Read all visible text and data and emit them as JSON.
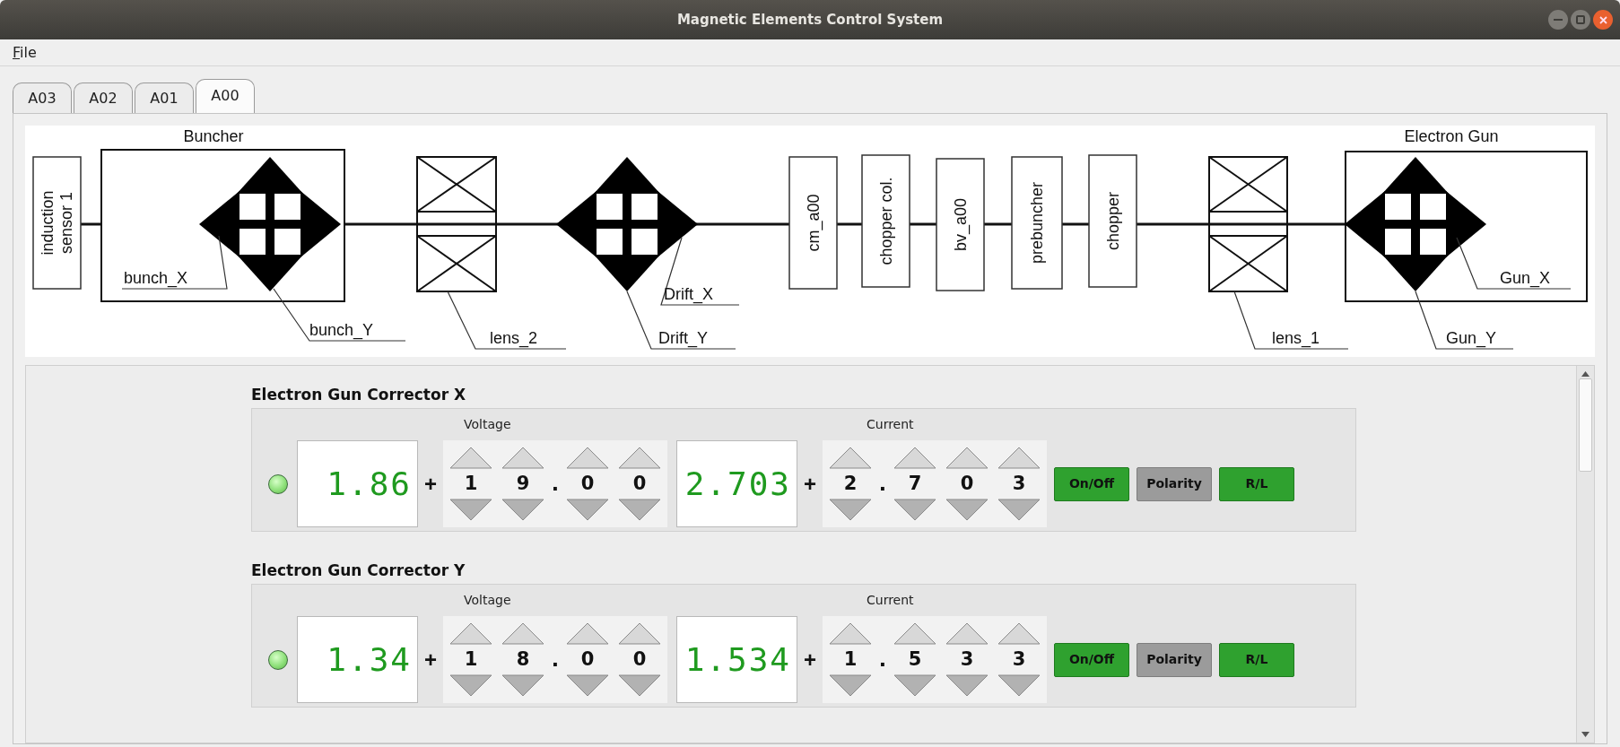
{
  "window": {
    "title": "Magnetic Elements Control System"
  },
  "menu": [
    {
      "label": "File"
    }
  ],
  "tabs": [
    {
      "label": "A03",
      "selected": false
    },
    {
      "label": "A02",
      "selected": false
    },
    {
      "label": "A01",
      "selected": false
    },
    {
      "label": "A00",
      "selected": true
    }
  ],
  "diagram": {
    "frames": [
      {
        "title": "Buncher"
      },
      {
        "title": "Electron Gun"
      }
    ],
    "boxes": [
      {
        "lines": [
          "induction",
          "sensor 1"
        ]
      },
      {
        "lines": [
          "cm_a00"
        ]
      },
      {
        "lines": [
          "chopper col."
        ]
      },
      {
        "lines": [
          "bv_a00"
        ]
      },
      {
        "lines": [
          "prebuncher"
        ]
      },
      {
        "lines": [
          "chopper"
        ]
      }
    ],
    "labels": [
      "bunch_X",
      "bunch_Y",
      "lens_2",
      "Drift_X",
      "Drift_Y",
      "lens_1",
      "Gun_X",
      "Gun_Y"
    ]
  },
  "correctors": [
    {
      "title": "Electron Gun Corrector X",
      "indicator_on": true,
      "voltage": {
        "label": "Voltage",
        "display": "1.86",
        "sign": "+",
        "digits": [
          {
            "kind": "digit",
            "text": "1"
          },
          {
            "kind": "digit",
            "text": "9"
          },
          {
            "kind": "point",
            "text": "."
          },
          {
            "kind": "digit",
            "text": "0"
          },
          {
            "kind": "digit",
            "text": "0"
          }
        ]
      },
      "current": {
        "label": "Current",
        "display": "2.703",
        "sign": "+",
        "digits": [
          {
            "kind": "digit",
            "text": "2"
          },
          {
            "kind": "point",
            "text": "."
          },
          {
            "kind": "digit",
            "text": "7"
          },
          {
            "kind": "digit",
            "text": "0"
          },
          {
            "kind": "digit",
            "text": "3"
          }
        ]
      },
      "buttons": [
        {
          "label": "On/Off",
          "active": true
        },
        {
          "label": "Polarity",
          "active": false
        },
        {
          "label": "R/L",
          "active": true
        }
      ]
    },
    {
      "title": "Electron Gun Corrector Y",
      "indicator_on": true,
      "voltage": {
        "label": "Voltage",
        "display": "1.34",
        "sign": "+",
        "digits": [
          {
            "kind": "digit",
            "text": "1"
          },
          {
            "kind": "digit",
            "text": "8"
          },
          {
            "kind": "point",
            "text": "."
          },
          {
            "kind": "digit",
            "text": "0"
          },
          {
            "kind": "digit",
            "text": "0"
          }
        ]
      },
      "current": {
        "label": "Current",
        "display": "1.534",
        "sign": "+",
        "digits": [
          {
            "kind": "digit",
            "text": "1"
          },
          {
            "kind": "point",
            "text": "."
          },
          {
            "kind": "digit",
            "text": "5"
          },
          {
            "kind": "digit",
            "text": "3"
          },
          {
            "kind": "digit",
            "text": "3"
          }
        ]
      },
      "buttons": [
        {
          "label": "On/Off",
          "active": true
        },
        {
          "label": "Polarity",
          "active": false
        },
        {
          "label": "R/L",
          "active": true
        }
      ]
    }
  ]
}
